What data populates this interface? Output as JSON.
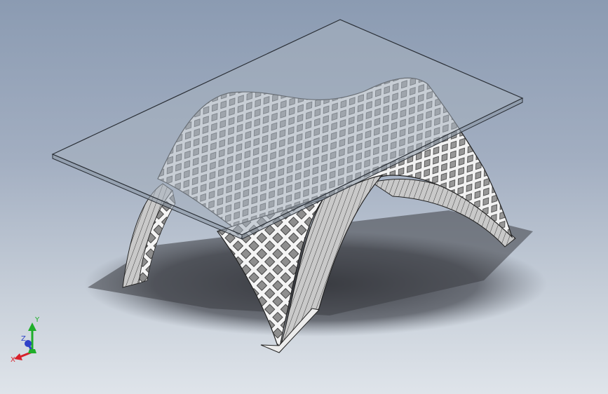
{
  "viewport": {
    "background_top": "#8b9bb2",
    "background_bottom": "#dfe4ea",
    "glass_color": "#a6b1bd",
    "lattice_face_color": "#f4f4f4",
    "lattice_hole_color": "#8e8e8e",
    "shadow_color": "#3c3e44"
  },
  "triad": {
    "x_label": "X",
    "y_label": "Y",
    "z_label": "Z",
    "x_color": "#d8202a",
    "y_color": "#1fae2a",
    "z_color": "#3042c8"
  }
}
